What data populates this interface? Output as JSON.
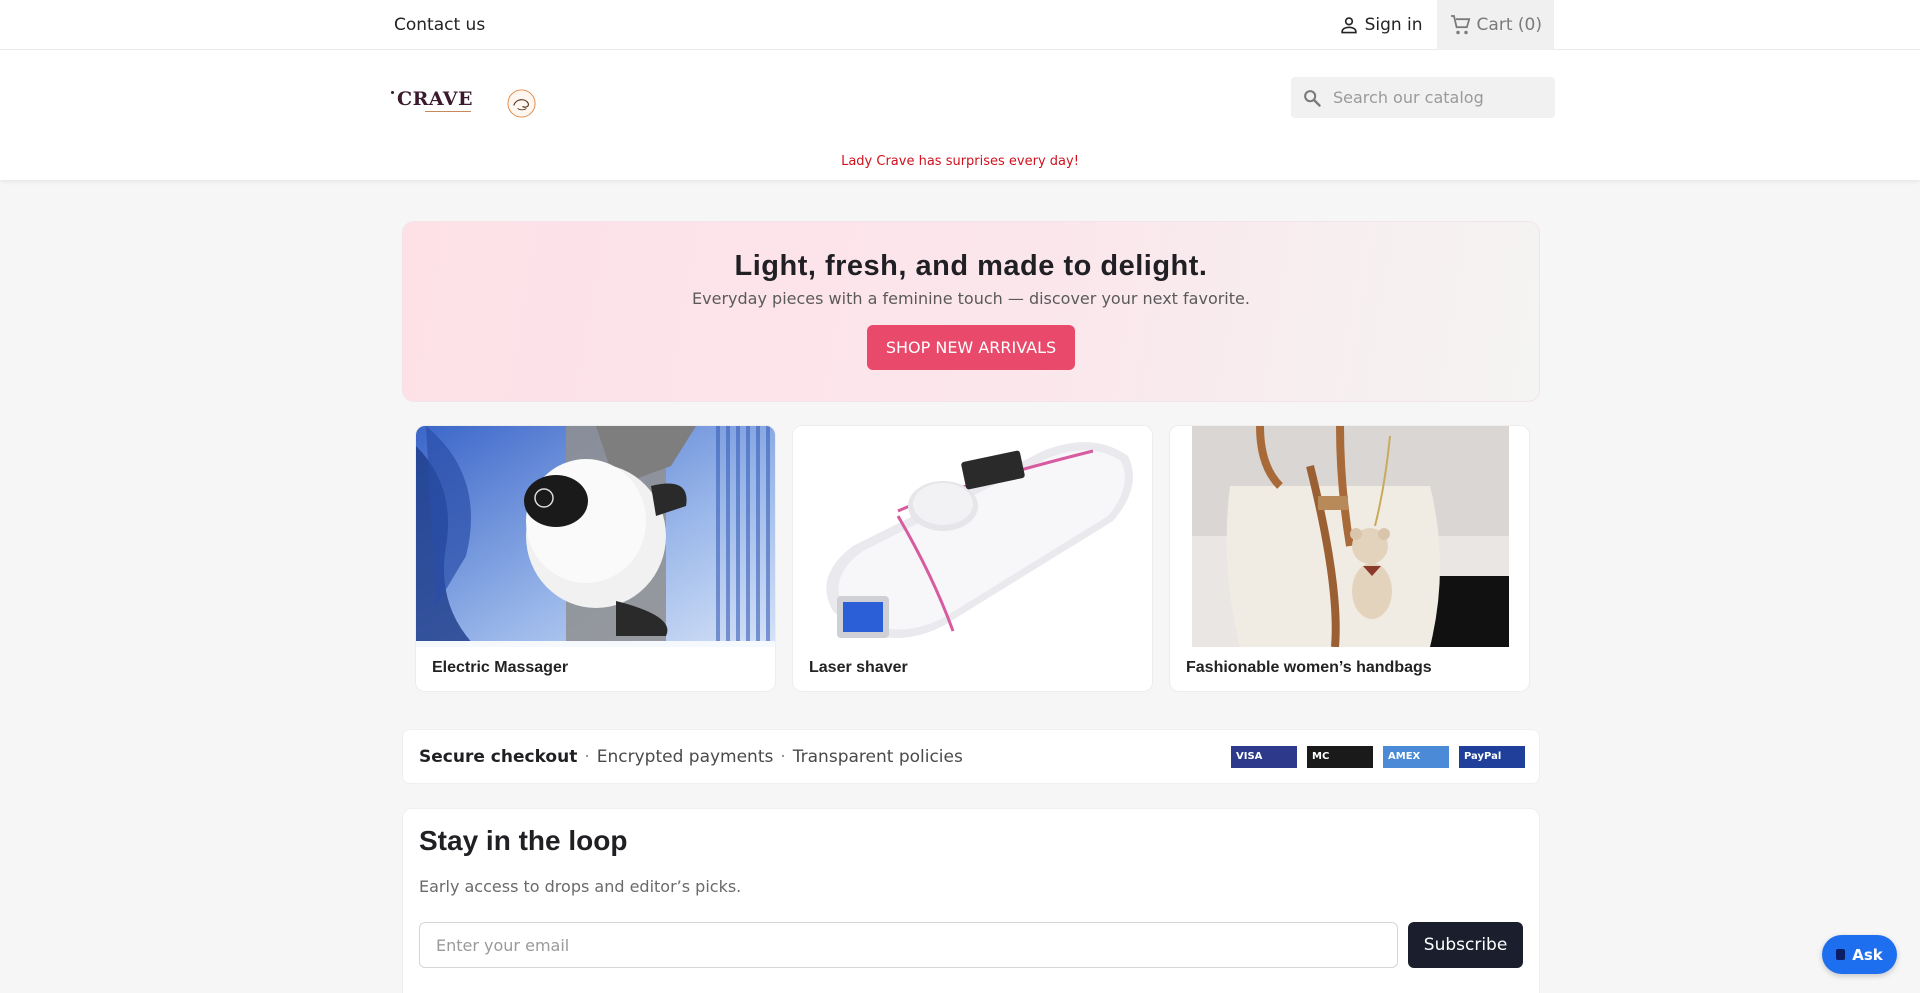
{
  "topnav": {
    "contact_label": "Contact us",
    "signin_label": "Sign in",
    "cart_label": "Cart",
    "cart_count": "(0)"
  },
  "header": {
    "logo_text": "CRAVE",
    "search_placeholder": "Search our catalog",
    "promo_text": "Lady Crave has surprises every day!"
  },
  "hero": {
    "title": "Light, fresh, and made to delight.",
    "subtitle": "Everyday pieces with a feminine touch — discover your next favorite.",
    "button_label": "SHOP NEW ARRIVALS"
  },
  "products": [
    {
      "title": "Electric Massager"
    },
    {
      "title": "Laser shaver"
    },
    {
      "title": "Fashionable women’s handbags"
    }
  ],
  "trust": {
    "primary": "Secure checkout",
    "separator": "·",
    "item_2": "Encrypted payments",
    "item_3": "Transparent policies",
    "payments": [
      {
        "label": "VISA",
        "color": "#2d3a8c"
      },
      {
        "label": "MC",
        "color": "#1a1a1a"
      },
      {
        "label": "AMEX",
        "color": "#4a8ad6"
      },
      {
        "label": "PayPal",
        "color": "#1f3f9a"
      }
    ]
  },
  "newsletter": {
    "title": "Stay in the loop",
    "subtitle": "Early access to drops and editor’s picks.",
    "email_placeholder": "Enter your email",
    "subscribe_label": "Subscribe"
  },
  "ask_widget": {
    "label": "Ask"
  },
  "colors": {
    "accent": "#e94a6b",
    "promo_red": "#d1111d",
    "dark_button": "#1b1f2d",
    "ask_blue": "#1e6ef0"
  }
}
